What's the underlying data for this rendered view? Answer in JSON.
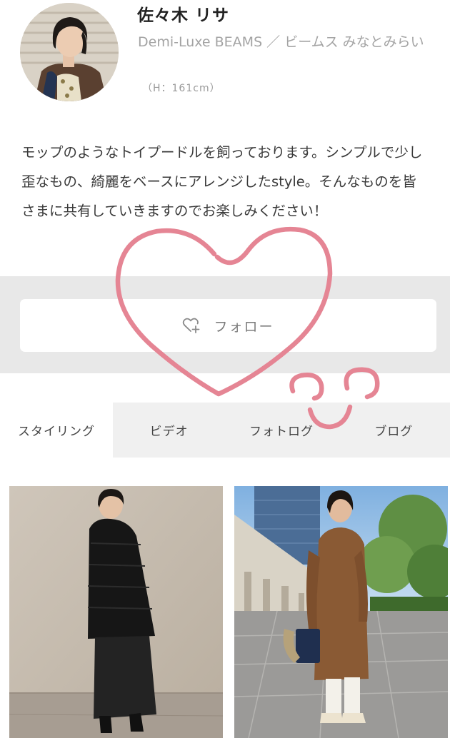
{
  "profile": {
    "name": "佐々木 リサ",
    "shop": "Demi-Luxe BEAMS ／ ビームス みなとみらい",
    "height": "（H：161cm）",
    "bio": "モップのようなトイプードルを飼っております。シンプルで少し歪なもの、綺麗をベースにアレンジしたstyle。そんなものを皆さまに共有していきますのでお楽しみください！"
  },
  "follow": {
    "label": "フォロー",
    "icon": "heart-plus-icon"
  },
  "tabs": [
    {
      "label": "スタイリング",
      "active": true
    },
    {
      "label": "ビデオ",
      "active": false
    },
    {
      "label": "フォトログ",
      "active": false
    },
    {
      "label": "ブログ",
      "active": false
    }
  ],
  "colors": {
    "doodle": "#e58594",
    "band": "#e8e8e8",
    "tab_bar": "#f0f0f0",
    "muted_text": "#a3a3a3"
  }
}
